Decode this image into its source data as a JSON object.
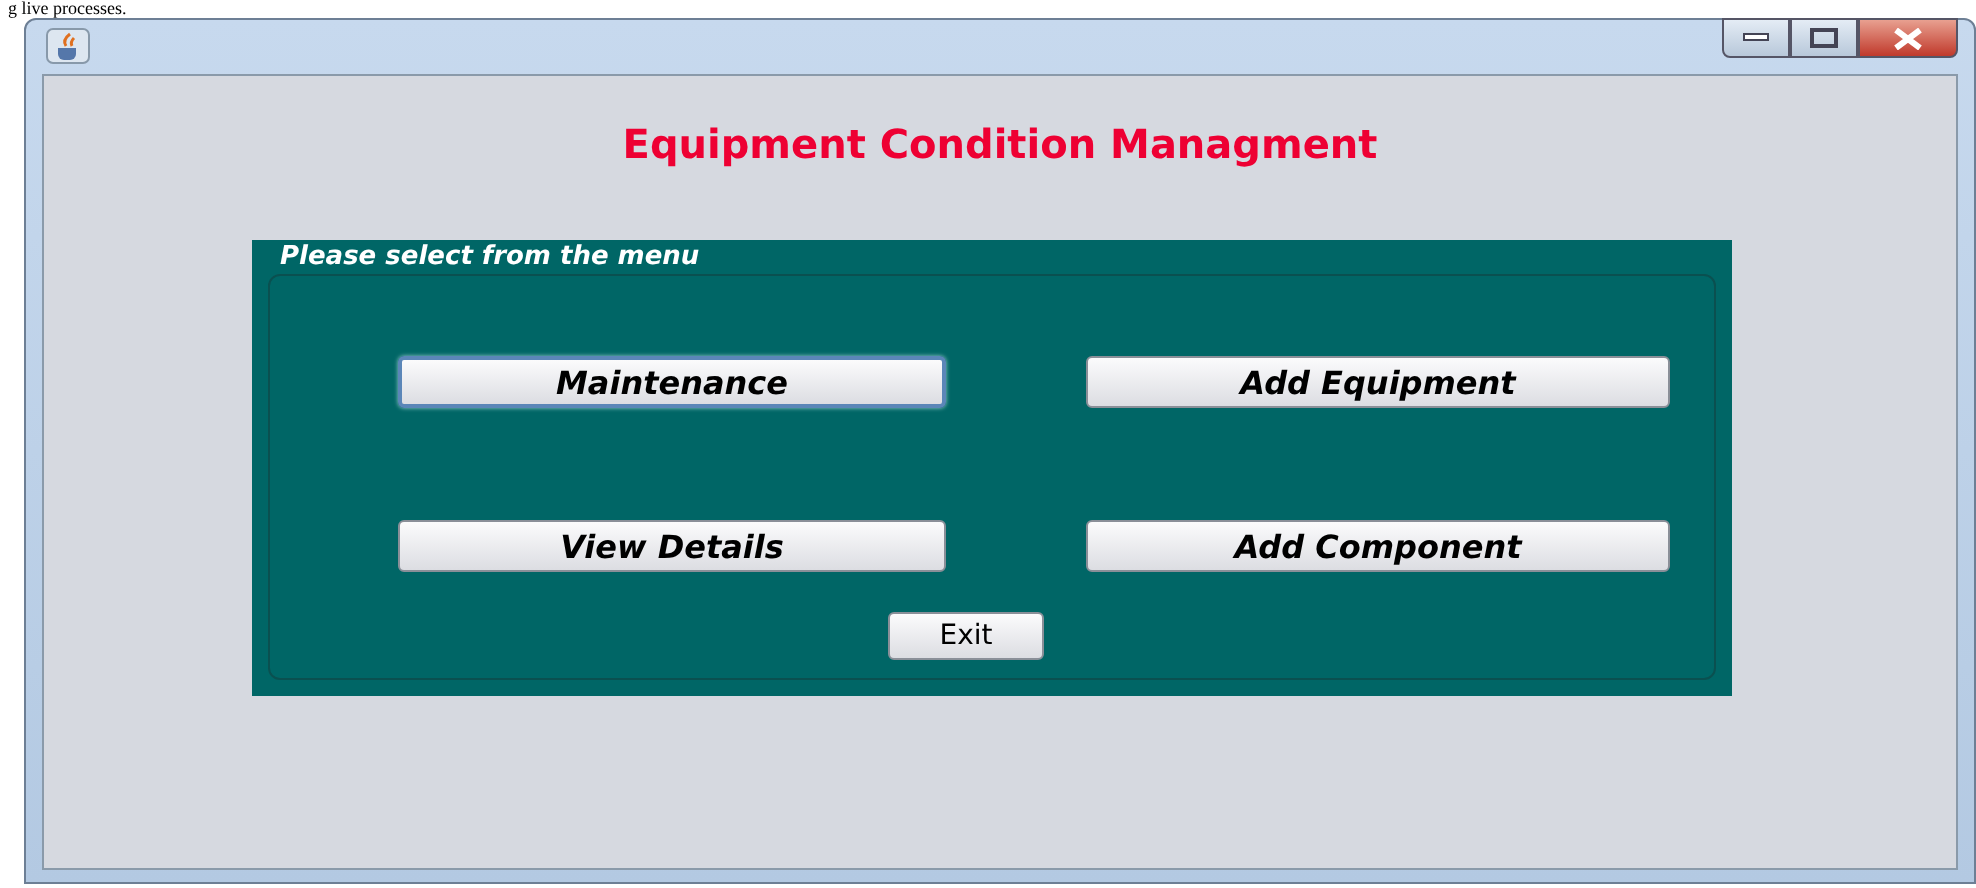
{
  "document_text": "g live processes.",
  "window": {
    "title_bar_buttons": [
      {
        "kind": "minimize"
      },
      {
        "kind": "maximize"
      },
      {
        "kind": "close"
      }
    ]
  },
  "heading": "Equipment Condition Managment",
  "menu_panel": {
    "title": "Please select from the menu",
    "buttons": [
      {
        "label": "Maintenance",
        "focused": true
      },
      {
        "label": "Add Equipment",
        "focused": false
      },
      {
        "label": "View Details",
        "focused": false
      },
      {
        "label": "Add Component",
        "focused": false
      }
    ],
    "exit_button": {
      "label": "Exit",
      "focused": false
    }
  }
}
